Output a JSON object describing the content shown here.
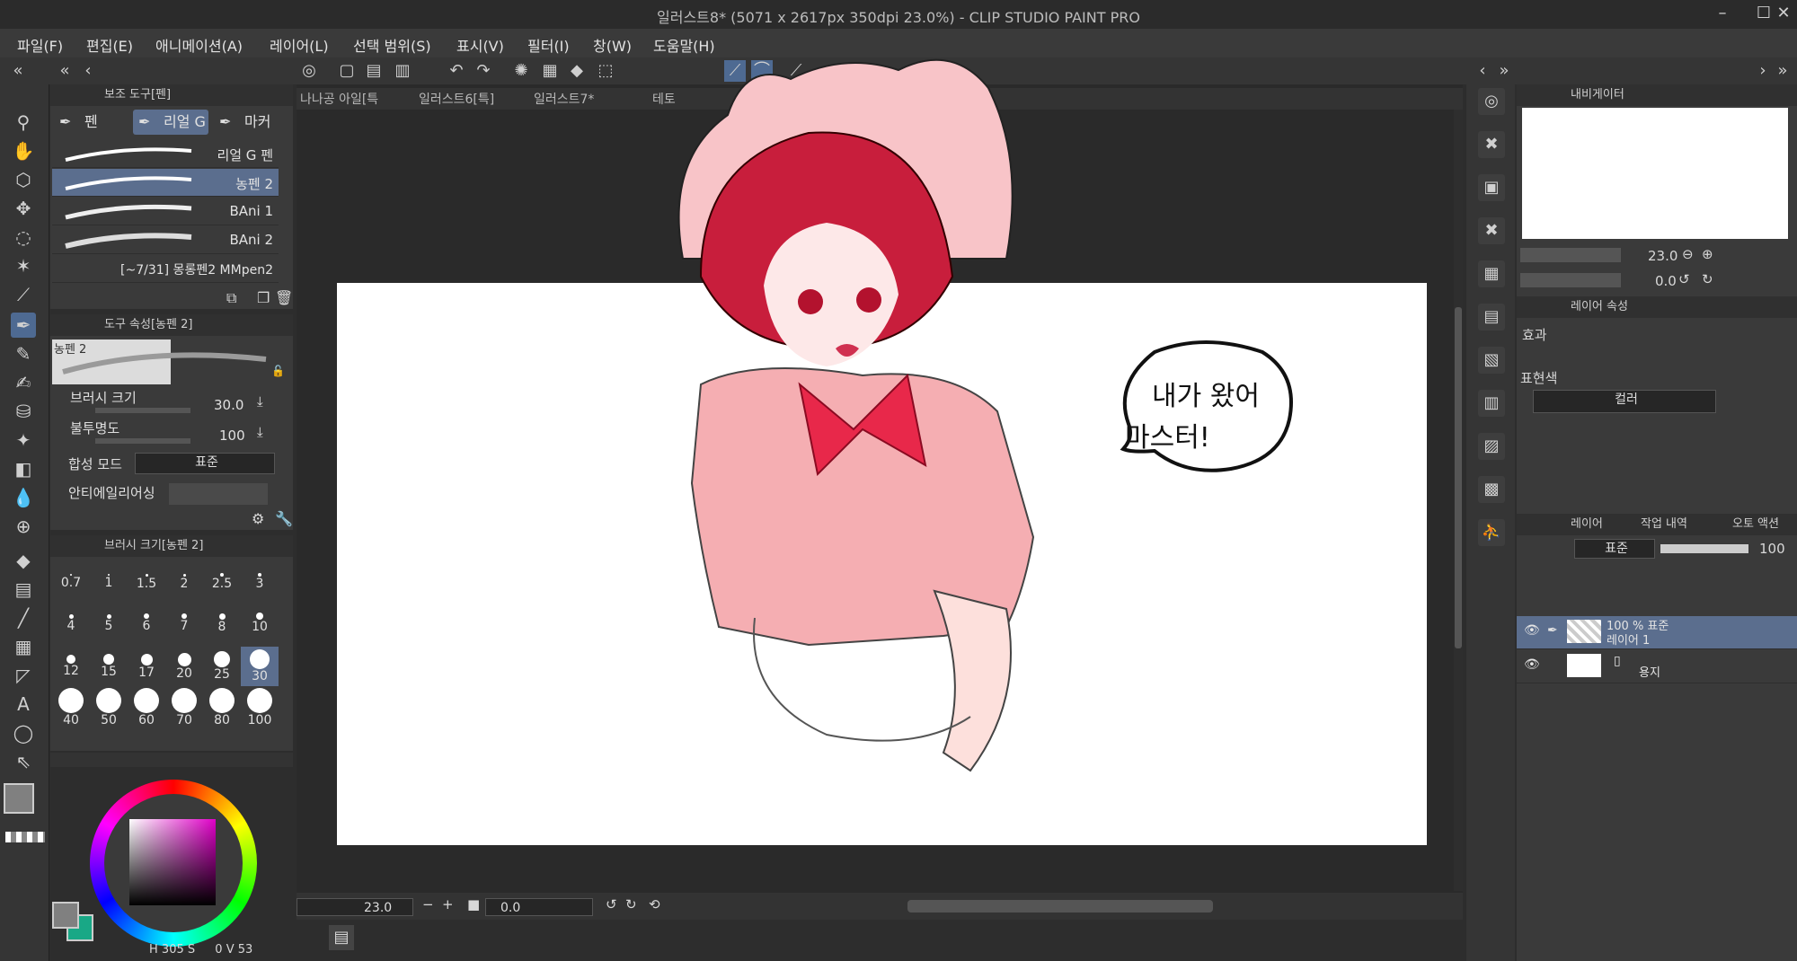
{
  "window": {
    "title": "일러스트8* (5071 x 2617px 350dpi 23.0%)  - CLIP STUDIO PAINT PRO",
    "min_icon": "minimize-icon",
    "max_icon": "maximize-icon",
    "close_icon": "close-icon"
  },
  "menu": [
    "파일(F)",
    "편집(E)",
    "애니메이션(A)",
    "레이어(L)",
    "선택 범위(S)",
    "표시(V)",
    "필터(I)",
    "창(W)",
    "도움말(H)"
  ],
  "doc_tabs": [
    "나나공 아일[특",
    "일러스트6[특]",
    "일러스트7*",
    "테토"
  ],
  "sub_tool_panel": {
    "title": "보조 도구[펜]",
    "tabs": [
      "펜",
      "리얼 G",
      "마커"
    ],
    "brushes": [
      "리얼 G 펜",
      "농펜 2",
      "BAni 1",
      "BAni 2",
      "[~7/31] 몽롱펜2 MMpen2"
    ],
    "selected_brush": "농펜 2"
  },
  "tool_property": {
    "title": "도구 속성[농펜 2]",
    "preview_label": "농펜 2",
    "brush_size_label": "브러시 크기",
    "brush_size_value": "30.0",
    "opacity_label": "불투명도",
    "opacity_value": "100",
    "blend_label": "합성 모드",
    "blend_value": "표준",
    "aa_label": "안티에일리어싱"
  },
  "brush_size_panel": {
    "title": "브러시 크기[농펜 2]",
    "sizes": [
      "0.7",
      "1",
      "1.5",
      "2",
      "2.5",
      "3",
      "4",
      "5",
      "6",
      "7",
      "8",
      "10",
      "12",
      "15",
      "17",
      "20",
      "25",
      "30",
      "40",
      "50",
      "60",
      "70",
      "80",
      "100"
    ],
    "selected": "30"
  },
  "color": {
    "main": "#808080",
    "sub": "#19a886",
    "hsv_h": "305",
    "hsv_s": "0",
    "hsv_v": "53",
    "h_label": "H",
    "s_label": "S",
    "v_label": "V"
  },
  "canvas": {
    "speech_line1": "내가 왔어",
    "speech_line2": "마스터!"
  },
  "bottom": {
    "zoom": "23.0",
    "angle": "0.0"
  },
  "navigator": {
    "title": "내비게이터",
    "zoom": "23.0",
    "angle": "0.0"
  },
  "layer_property": {
    "title": "레이어 속성",
    "effect_label": "효과",
    "expression_label": "표현색",
    "expression_value": "컬러"
  },
  "layers_panel": {
    "tabs": [
      "레이어",
      "작업 내역",
      "오토 액션"
    ],
    "blend": "표준",
    "opacity": "100",
    "layers": [
      {
        "line1": "100 % 표준",
        "line2": "레이어 1"
      },
      {
        "line1": "",
        "line2": "용지"
      }
    ]
  }
}
